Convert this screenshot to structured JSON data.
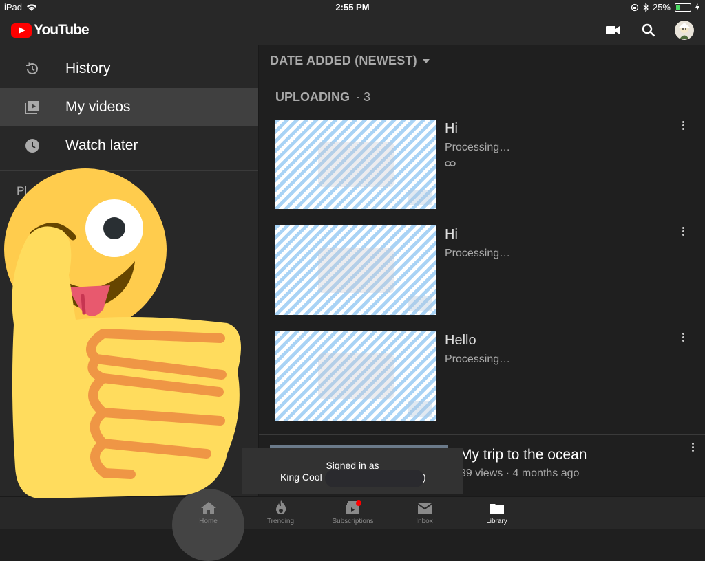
{
  "status_bar": {
    "device": "iPad",
    "time": "2:55 PM",
    "battery": "25%"
  },
  "app": {
    "logo_text": "YouTube"
  },
  "sidebar": {
    "items": [
      {
        "label": "History",
        "icon": "history-icon"
      },
      {
        "label": "My videos",
        "icon": "my-videos-icon",
        "active": true
      },
      {
        "label": "Watch later",
        "icon": "clock-icon"
      }
    ],
    "playlists_label": "Pl"
  },
  "sort": {
    "label": "DATE ADDED (NEWEST)"
  },
  "uploading": {
    "label": "UPLOADING",
    "count": "· 3",
    "videos": [
      {
        "title": "Hi",
        "status": "Processing…",
        "unlisted": true
      },
      {
        "title": "Hi",
        "status": "Processing…"
      },
      {
        "title": "Hello",
        "status": "Processing…"
      }
    ]
  },
  "published": [
    {
      "title": "My trip to the ocean",
      "meta": "39 views · 4 months ago"
    }
  ],
  "toast": {
    "line1": "Signed in as",
    "line2": "King Cool (",
    "line2_end": ")"
  },
  "bottom_nav": [
    {
      "label": "Home",
      "icon": "home-icon"
    },
    {
      "label": "Trending",
      "icon": "trending-icon"
    },
    {
      "label": "Subscriptions",
      "icon": "subscriptions-icon"
    },
    {
      "label": "Inbox",
      "icon": "inbox-icon"
    },
    {
      "label": "Library",
      "icon": "library-icon",
      "active": true
    }
  ],
  "colors": {
    "brand_red": "#ff0000",
    "background": "#1f1f1f",
    "panel": "#282828",
    "battery_green": "#4cd964"
  }
}
